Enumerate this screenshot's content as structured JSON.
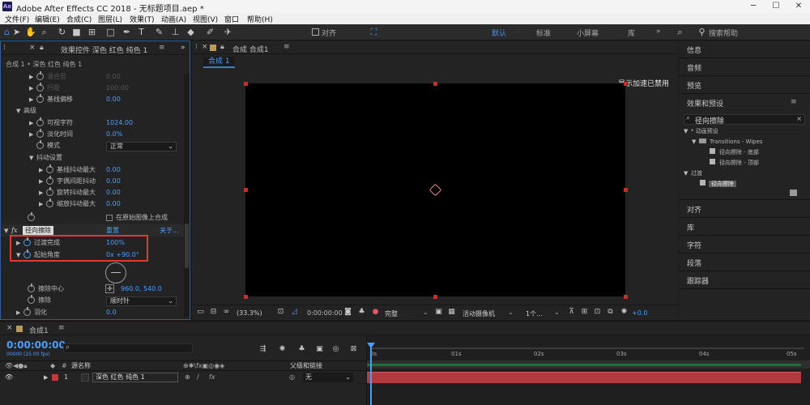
{
  "titlebar": {
    "app_icon": "Ae",
    "title": "Adobe After Effects CC 2018 - 无标题项目.aep *"
  },
  "menu": [
    "文件(F)",
    "编辑(E)",
    "合成(C)",
    "图层(L)",
    "效果(T)",
    "动画(A)",
    "视图(V)",
    "窗口",
    "帮助(H)"
  ],
  "toolbar": {
    "align_label": "对齐",
    "workspaces": [
      "默认",
      "标准",
      "小屏幕",
      "库"
    ],
    "active_workspace": "默认",
    "search_placeholder": "搜索帮助"
  },
  "effects_panel": {
    "tab_label": "效果控件 深色 红色 纯色 1",
    "breadcrumb": "合成 1 • 深色 红色 纯色 1",
    "rows": [
      {
        "label": "混合层",
        "value": "0.00",
        "dim": true
      },
      {
        "label": "行距",
        "value": "100.00",
        "dim": true
      },
      {
        "label": "基线偏移",
        "value": "0.00"
      },
      {
        "label": "高级",
        "value": ""
      },
      {
        "label": "可视字符",
        "value": "1024.00"
      },
      {
        "label": "淡化时间",
        "value": "0.0%"
      },
      {
        "label": "模式",
        "value": "正常"
      },
      {
        "label": "抖动设置",
        "value": ""
      },
      {
        "label": "基线抖动最大",
        "value": "0.00"
      },
      {
        "label": "字偶间距抖动",
        "value": "0.00"
      },
      {
        "label": "旋转抖动最大",
        "value": "0.00"
      },
      {
        "label": "缩放抖动最大",
        "value": "0.00"
      }
    ],
    "composite_checkbox": "在原始图像上合成",
    "fx_name": "径向擦除",
    "fx_reset": "重置",
    "fx_about": "关于...",
    "transition_label": "过渡完成",
    "transition_value": "100%",
    "start_angle_label": "起始角度",
    "start_angle_value": "0x +90.0°",
    "wipe_center_label": "擦除中心",
    "wipe_center_value": "960.0, 540.0",
    "wipe_label": "擦除",
    "wipe_value": "顺时针",
    "feather_label": "羽化",
    "feather_value": "0.0"
  },
  "comp_panel": {
    "tab_label": "合成 合成1",
    "flowchart_tab": "合成 1",
    "gpu_notice": "显示加速已禁用",
    "zoom": "(33.3%)",
    "timecode": "0:00:00:00",
    "resolution": "完整",
    "camera": "活动摄像机",
    "views": "1个...",
    "exposure": "+0.0"
  },
  "right_panel": {
    "items_top": [
      "信息",
      "音频",
      "预览",
      "效果和预设"
    ],
    "search_value": "径向擦除",
    "tree": [
      {
        "label": "* 动画预设",
        "indent": 0
      },
      {
        "label": "Transitions - Wipes",
        "indent": 1
      },
      {
        "label": "径向擦除 - 底部",
        "indent": 2
      },
      {
        "label": "径向擦除 - 顶部",
        "indent": 2
      },
      {
        "label": "过渡",
        "indent": 0
      },
      {
        "label": "径向擦除",
        "indent": 1,
        "selected": true
      }
    ],
    "items_bottom": [
      "对齐",
      "库",
      "字符",
      "段落",
      "跟踪器"
    ]
  },
  "timeline": {
    "comp_tab": "合成1",
    "timecode": "0:00:00:00",
    "timecode_sub": "00000 (25.00 fps)",
    "search_placeholder": "",
    "col_source": "源名称",
    "col_parent": "父级和链接",
    "layer_index": "1",
    "layer_name": "深色 红色 纯色 1",
    "parent_value": "无",
    "ticks": [
      "0s",
      "01s",
      "02s",
      "03s",
      "04s",
      "05s"
    ]
  },
  "colors": {
    "accent_blue": "#4a9eff",
    "highlight_red": "#e23a32",
    "layer_bar": "#b03a3e",
    "workarea_green": "#1f6f3c"
  }
}
